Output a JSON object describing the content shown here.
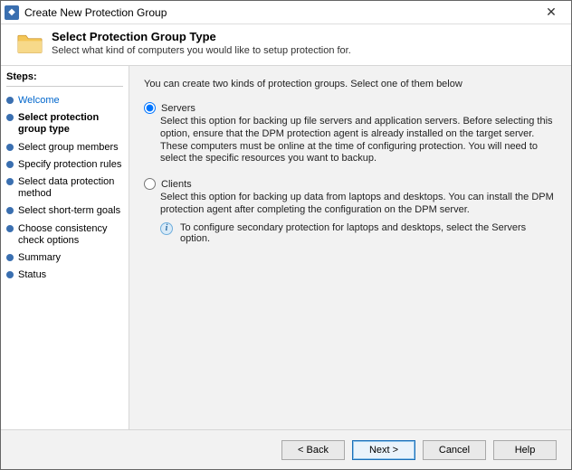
{
  "window": {
    "title": "Create New Protection Group"
  },
  "header": {
    "title": "Select Protection Group Type",
    "subtitle": "Select what kind of computers you would like to setup protection for."
  },
  "sidebar": {
    "heading": "Steps:",
    "items": [
      {
        "label": "Welcome",
        "style": "link"
      },
      {
        "label": "Select protection group type",
        "style": "bold"
      },
      {
        "label": "Select group members",
        "style": "normal"
      },
      {
        "label": "Specify protection rules",
        "style": "normal"
      },
      {
        "label": "Select data protection method",
        "style": "normal"
      },
      {
        "label": "Select short-term goals",
        "style": "normal"
      },
      {
        "label": "Choose consistency check options",
        "style": "normal"
      },
      {
        "label": "Summary",
        "style": "normal"
      },
      {
        "label": "Status",
        "style": "normal"
      }
    ]
  },
  "content": {
    "intro": "You can create two kinds of protection groups. Select one of them below",
    "options": {
      "servers": {
        "label": "Servers",
        "checked": true,
        "desc": "Select this option for backing up file servers and application servers. Before selecting this option, ensure that the DPM protection agent is already installed on the target server. These computers must be online at the time of configuring protection. You will need to select the specific resources you want to backup."
      },
      "clients": {
        "label": "Clients",
        "checked": false,
        "desc": "Select this option for backing up data from laptops and desktops. You can install the DPM protection agent after completing the configuration on the DPM server.",
        "info": "To configure secondary protection for laptops and desktops, select the Servers option."
      }
    }
  },
  "footer": {
    "back": "< Back",
    "next": "Next >",
    "cancel": "Cancel",
    "help": "Help"
  }
}
